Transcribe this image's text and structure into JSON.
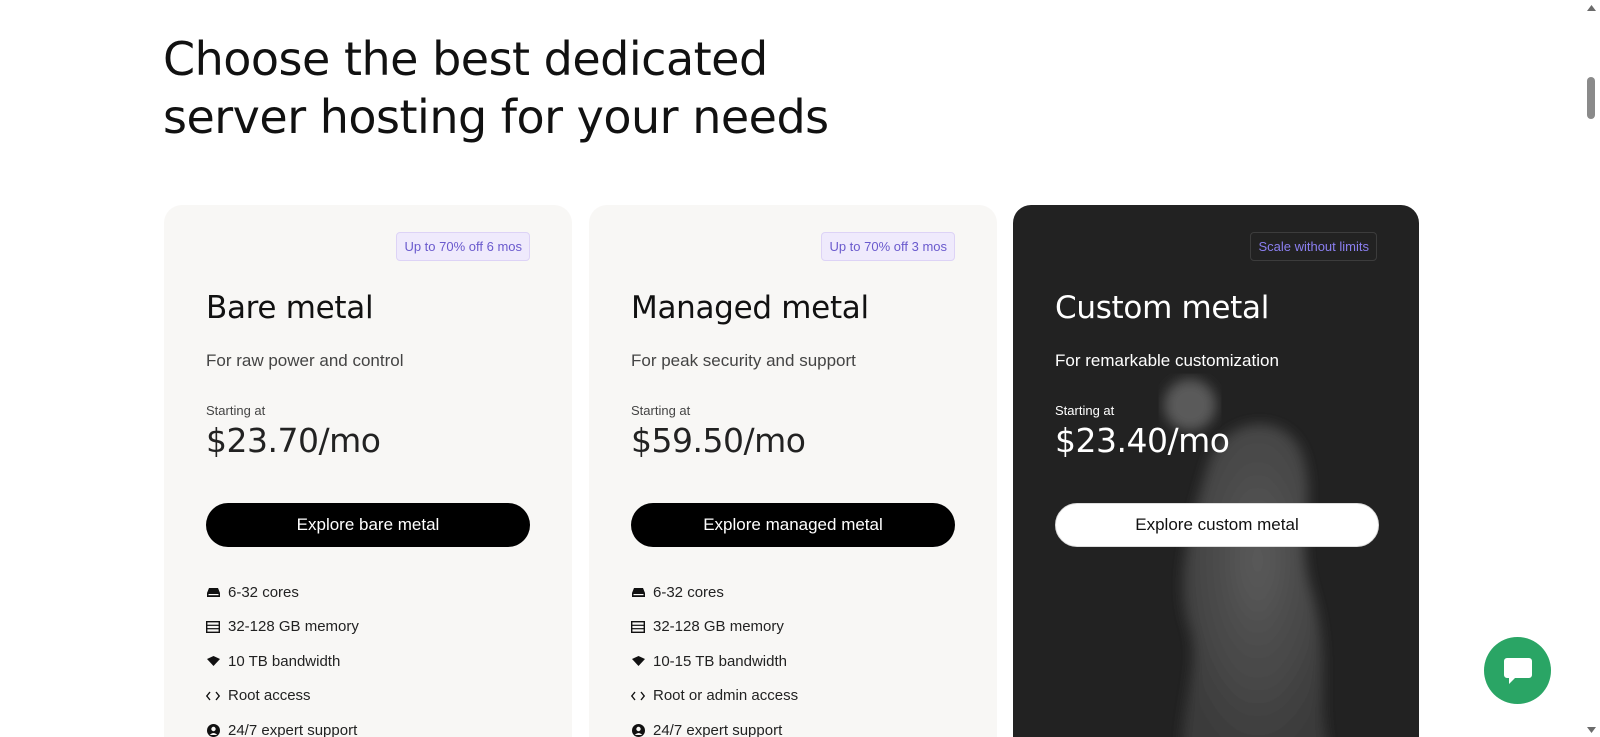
{
  "page": {
    "heading": "Choose the best dedicated server hosting for your needs"
  },
  "plans": [
    {
      "badge": "Up to 70% off 6 mos",
      "title": "Bare metal",
      "subtitle": "For raw power and control",
      "starting_label": "Starting at",
      "price": "$23.70/mo",
      "cta": "Explore bare metal",
      "features": [
        {
          "icon": "cpu-icon",
          "text": "6-32 cores"
        },
        {
          "icon": "memory-icon",
          "text": "32-128 GB memory"
        },
        {
          "icon": "bandwidth-icon",
          "text": "10 TB bandwidth"
        },
        {
          "icon": "code-icon",
          "text": "Root access"
        },
        {
          "icon": "user-icon",
          "text": "24/7 expert support"
        }
      ]
    },
    {
      "badge": "Up to 70% off 3 mos",
      "title": "Managed metal",
      "subtitle": "For peak security and support",
      "starting_label": "Starting at",
      "price": "$59.50/mo",
      "cta": "Explore managed metal",
      "features": [
        {
          "icon": "cpu-icon",
          "text": "6-32 cores"
        },
        {
          "icon": "memory-icon",
          "text": "32-128 GB memory"
        },
        {
          "icon": "bandwidth-icon",
          "text": "10-15 TB bandwidth"
        },
        {
          "icon": "code-icon",
          "text": "Root or admin access"
        },
        {
          "icon": "user-icon",
          "text": "24/7 expert support"
        }
      ]
    },
    {
      "badge": "Scale without limits",
      "title": "Custom metal",
      "subtitle": "For remarkable customization",
      "starting_label": "Starting at",
      "price": "$23.40/mo",
      "cta": "Explore custom metal",
      "features": []
    }
  ],
  "colors": {
    "accent_purple": "#6a5acd",
    "chat_green": "#2aa565",
    "dark_card": "#222222",
    "light_card": "#f8f7f5"
  },
  "chat": {
    "icon": "chat-bubble-icon"
  }
}
